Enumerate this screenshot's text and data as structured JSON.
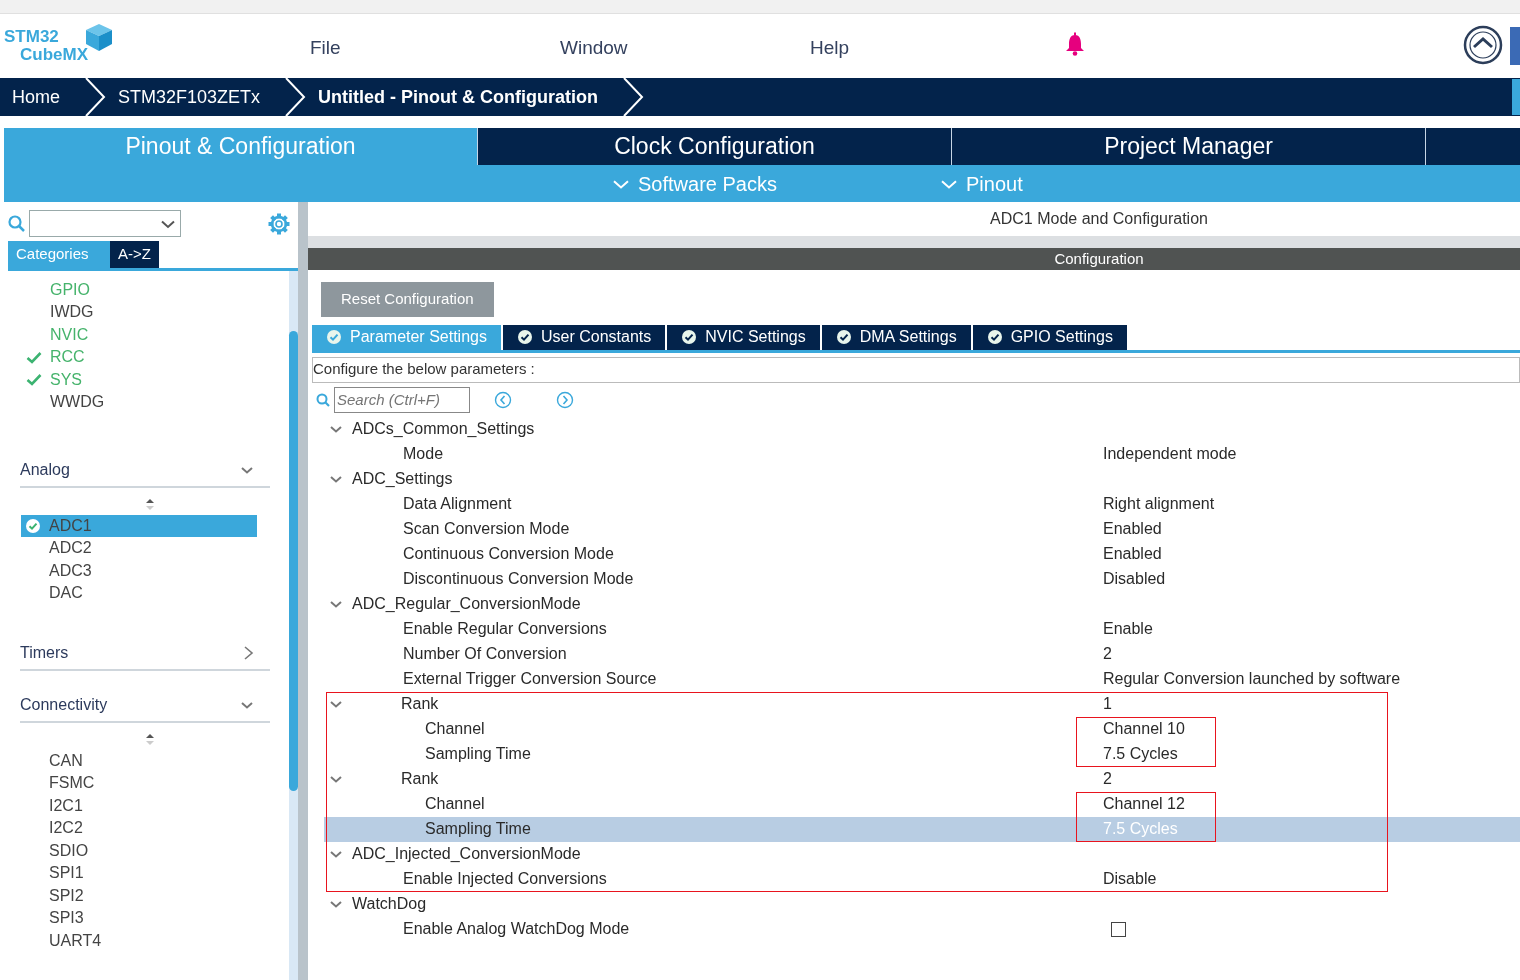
{
  "menu": [
    {
      "label": "File"
    },
    {
      "label": "Window"
    },
    {
      "label": "Help"
    }
  ],
  "logo": {
    "line1": "STM32",
    "line2": "CubeMX"
  },
  "breadcrumb": [
    {
      "label": "Home",
      "current": false
    },
    {
      "label": "STM32F103ZETx",
      "current": false
    },
    {
      "label": "Untitled - Pinout & Configuration",
      "current": true
    }
  ],
  "main_tabs": [
    {
      "label": "Pinout & Configuration",
      "selected": true
    },
    {
      "label": "Clock Configuration",
      "selected": false
    },
    {
      "label": "Project Manager",
      "selected": false
    }
  ],
  "sub_menu": [
    {
      "label": "Software Packs"
    },
    {
      "label": "Pinout"
    }
  ],
  "sidebar": {
    "tabs": [
      {
        "label": "Categories",
        "selected": true
      },
      {
        "label": "A->Z",
        "selected": false
      }
    ],
    "items": [
      {
        "label": "GPIO",
        "configured": true,
        "checked": false
      },
      {
        "label": "IWDG",
        "configured": false,
        "checked": false
      },
      {
        "label": "NVIC",
        "configured": true,
        "checked": false
      },
      {
        "label": "RCC",
        "configured": true,
        "checked": true
      },
      {
        "label": "SYS",
        "configured": true,
        "checked": true
      },
      {
        "label": "WWDG",
        "configured": false,
        "checked": false
      }
    ],
    "sections": [
      {
        "title": "Analog",
        "expanded": true,
        "items": [
          {
            "label": "ADC1",
            "selected": true,
            "checked": true
          },
          {
            "label": "ADC2",
            "selected": false,
            "checked": false
          },
          {
            "label": "ADC3",
            "selected": false,
            "checked": false
          },
          {
            "label": "DAC",
            "selected": false,
            "checked": false
          }
        ]
      },
      {
        "title": "Timers",
        "expanded": false
      },
      {
        "title": "Connectivity",
        "expanded": true,
        "items": [
          {
            "label": "CAN",
            "selected": false,
            "checked": false
          },
          {
            "label": "FSMC",
            "selected": false,
            "checked": false
          },
          {
            "label": "I2C1",
            "selected": false,
            "checked": false
          },
          {
            "label": "I2C2",
            "selected": false,
            "checked": false
          },
          {
            "label": "SDIO",
            "selected": false,
            "checked": false
          },
          {
            "label": "SPI1",
            "selected": false,
            "checked": false
          },
          {
            "label": "SPI2",
            "selected": false,
            "checked": false
          },
          {
            "label": "SPI3",
            "selected": false,
            "checked": false
          },
          {
            "label": "UART4",
            "selected": false,
            "checked": false
          }
        ]
      }
    ]
  },
  "panel": {
    "title": "ADC1 Mode and Configuration",
    "config_header": "Configuration",
    "reset_button": "Reset Configuration",
    "tabs": [
      {
        "label": "Parameter Settings",
        "selected": true
      },
      {
        "label": "User Constants",
        "selected": false
      },
      {
        "label": "NVIC Settings",
        "selected": false
      },
      {
        "label": "DMA Settings",
        "selected": false
      },
      {
        "label": "GPIO Settings",
        "selected": false
      }
    ],
    "heading": "Configure the below parameters :",
    "search_placeholder": "Search (Ctrl+F)",
    "tree": [
      {
        "label": "ADCs_Common_Settings",
        "expanded": true,
        "selected": false,
        "outlined": false,
        "children": [
          {
            "label": "Mode",
            "kind": "text",
            "value": "Independent mode",
            "selected": false,
            "outlined": false,
            "value_framed": false
          }
        ]
      },
      {
        "label": "ADC_Settings",
        "expanded": true,
        "selected": false,
        "outlined": false,
        "children": [
          {
            "label": "Data Alignment",
            "kind": "text",
            "value": "Right alignment",
            "selected": false,
            "outlined": false,
            "value_framed": false
          },
          {
            "label": "Scan Conversion Mode",
            "kind": "text",
            "value": "Enabled",
            "selected": false,
            "outlined": false,
            "value_framed": false
          },
          {
            "label": "Continuous Conversion Mode",
            "kind": "text",
            "value": "Enabled",
            "selected": false,
            "outlined": false,
            "value_framed": false
          },
          {
            "label": "Discontinuous Conversion Mode",
            "kind": "text",
            "value": "Disabled",
            "selected": false,
            "outlined": false,
            "value_framed": false
          }
        ]
      },
      {
        "label": "ADC_Regular_ConversionMode",
        "expanded": true,
        "selected": false,
        "outlined": false,
        "children": [
          {
            "label": "Enable Regular Conversions",
            "kind": "text",
            "value": "Enable",
            "selected": false,
            "outlined": false,
            "value_framed": false
          },
          {
            "label": "Number Of Conversion",
            "kind": "text",
            "value": "2",
            "selected": false,
            "outlined": false,
            "value_framed": false
          },
          {
            "label": "External Trigger Conversion Source",
            "kind": "text",
            "value": "Regular Conversion launched by software",
            "selected": false,
            "outlined": false,
            "value_framed": false
          },
          {
            "label": "Rank",
            "kind": "text",
            "value": "1",
            "expanded": true,
            "selected": false,
            "outlined": true,
            "value_framed": false,
            "children": [
              {
                "label": "Channel",
                "kind": "text",
                "value": "Channel 10",
                "selected": false,
                "outlined": true,
                "value_framed": true
              },
              {
                "label": "Sampling Time",
                "kind": "text",
                "value": "7.5 Cycles",
                "selected": false,
                "outlined": true,
                "value_framed": true
              }
            ]
          },
          {
            "label": "Rank",
            "kind": "text",
            "value": "2",
            "expanded": true,
            "selected": false,
            "outlined": true,
            "value_framed": false,
            "children": [
              {
                "label": "Channel",
                "kind": "text",
                "value": "Channel 12",
                "selected": false,
                "outlined": true,
                "value_framed": true
              },
              {
                "label": "Sampling Time",
                "kind": "text",
                "value": "7.5 Cycles",
                "selected": true,
                "outlined": true,
                "value_framed": true
              }
            ]
          }
        ]
      },
      {
        "label": "ADC_Injected_ConversionMode",
        "expanded": true,
        "selected": false,
        "outlined": true,
        "children": [
          {
            "label": "Enable Injected Conversions",
            "kind": "text",
            "value": "Disable",
            "selected": false,
            "outlined": true,
            "value_framed": false
          }
        ]
      },
      {
        "label": "WatchDog",
        "expanded": true,
        "selected": false,
        "outlined": false,
        "children": [
          {
            "label": "Enable Analog WatchDog Mode",
            "kind": "checkbox",
            "checked": false,
            "selected": false,
            "outlined": false,
            "value_framed": false
          }
        ]
      }
    ]
  }
}
